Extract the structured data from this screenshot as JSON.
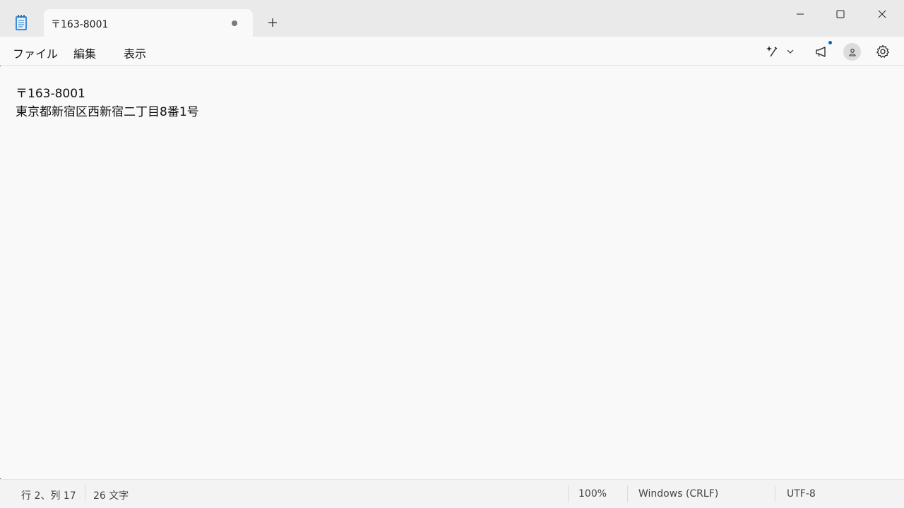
{
  "window": {
    "tab_title": "〒163-8001",
    "new_tab_symbol": "+",
    "controls": {
      "minimize": "minimize-icon",
      "maximize": "maximize-icon",
      "close": "close-icon"
    }
  },
  "menu": {
    "items": [
      "ファイル",
      "編集",
      "表示"
    ]
  },
  "toolbar": {
    "icons": [
      "copilot-sparkle-icon",
      "chevron-down-icon",
      "megaphone-icon",
      "account-icon",
      "gear-icon"
    ]
  },
  "editor": {
    "lines": [
      "〒163-8001",
      "東京都新宿区西新宿二丁目8番1号"
    ]
  },
  "status": {
    "position": "行 2、列 17",
    "char_count": "26 文字",
    "zoom": "100%",
    "line_ending": "Windows (CRLF)",
    "encoding": "UTF-8"
  },
  "colors": {
    "accent": "#0067c0",
    "titlebar": "#eaeaea",
    "editor_bg": "#f9f9f9"
  }
}
